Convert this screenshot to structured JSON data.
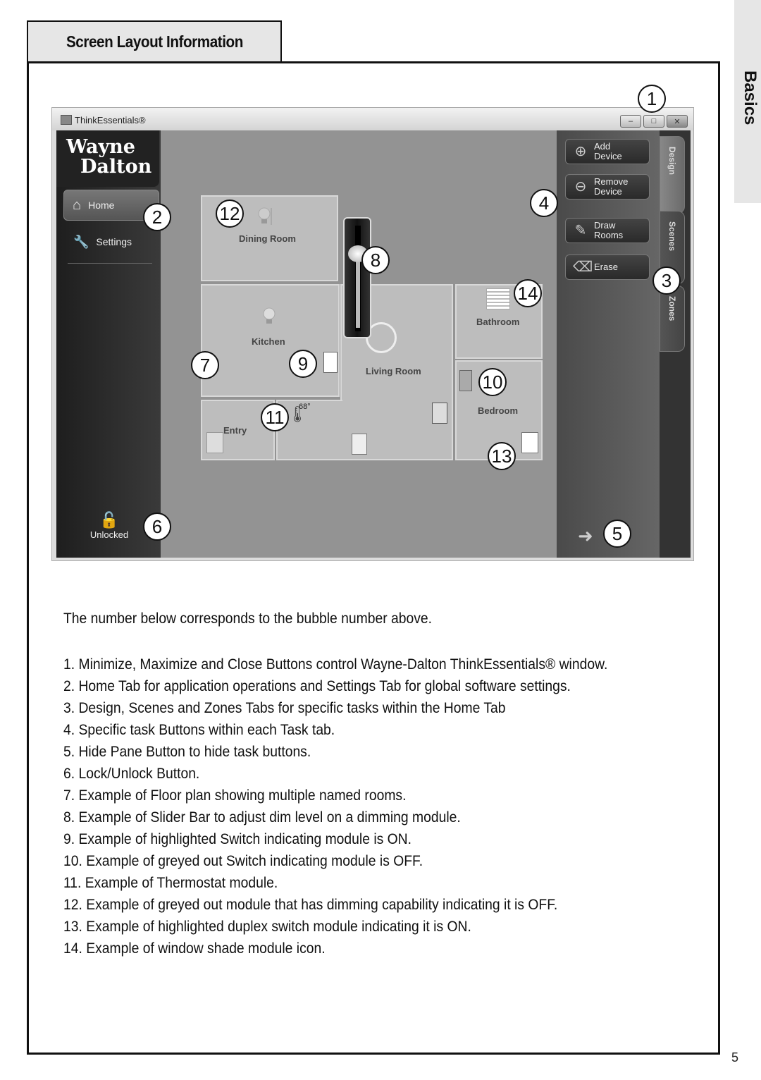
{
  "section_tab": "Screen Layout Information",
  "side_tab": "Basics",
  "page_number": "5",
  "app": {
    "title": "ThinkEssentials®",
    "window_buttons": [
      "minimize",
      "maximize",
      "close"
    ],
    "logo_line1": "Wayne",
    "logo_line2": "Dalton",
    "nav": {
      "home": "Home",
      "settings": "Settings"
    },
    "lock_label": "Unlocked",
    "task_buttons": [
      {
        "label1": "Add",
        "label2": "Device",
        "icon": "plus-circle-icon"
      },
      {
        "label1": "Remove",
        "label2": "Device",
        "icon": "minus-circle-icon"
      },
      {
        "label1": "Draw",
        "label2": "Rooms",
        "icon": "pencil-icon"
      },
      {
        "label1": "Erase",
        "label2": "",
        "icon": "eraser-icon"
      }
    ],
    "task_tabs": [
      "Design",
      "Scenes",
      "Zones"
    ],
    "rooms": {
      "dining": "Dining Room",
      "kitchen": "Kitchen",
      "living": "Living Room",
      "bathroom": "Bathroom",
      "bedroom": "Bedroom",
      "entry": "Entry"
    },
    "thermostat_temp": "68°"
  },
  "bubbles": [
    "1",
    "2",
    "3",
    "4",
    "5",
    "6",
    "7",
    "8",
    "9",
    "10",
    "11",
    "12",
    "13",
    "14"
  ],
  "intro": "The number below corresponds to the bubble number above.",
  "items": [
    "1.  Minimize, Maximize and Close Buttons control Wayne-Dalton ThinkEssentials® window.",
    "2.  Home Tab for application operations and Settings Tab for global software settings.",
    "3.  Design, Scenes and Zones Tabs for specific tasks within the Home Tab",
    "4.  Specific task Buttons within each Task tab.",
    "5.  Hide Pane Button to hide task buttons.",
    "6.  Lock/Unlock Button.",
    "7.  Example of Floor plan showing multiple named rooms.",
    "8.  Example of Slider Bar to adjust dim level on a dimming module.",
    "9.  Example of highlighted Switch indicating module is ON.",
    "10.  Example of greyed out Switch indicating module is OFF.",
    "11.  Example of Thermostat module.",
    "12.  Example of greyed out module that has dimming capability indicating it is OFF.",
    "13.  Example of highlighted duplex switch module indicating it is ON.",
    "14.  Example of window shade module icon."
  ]
}
